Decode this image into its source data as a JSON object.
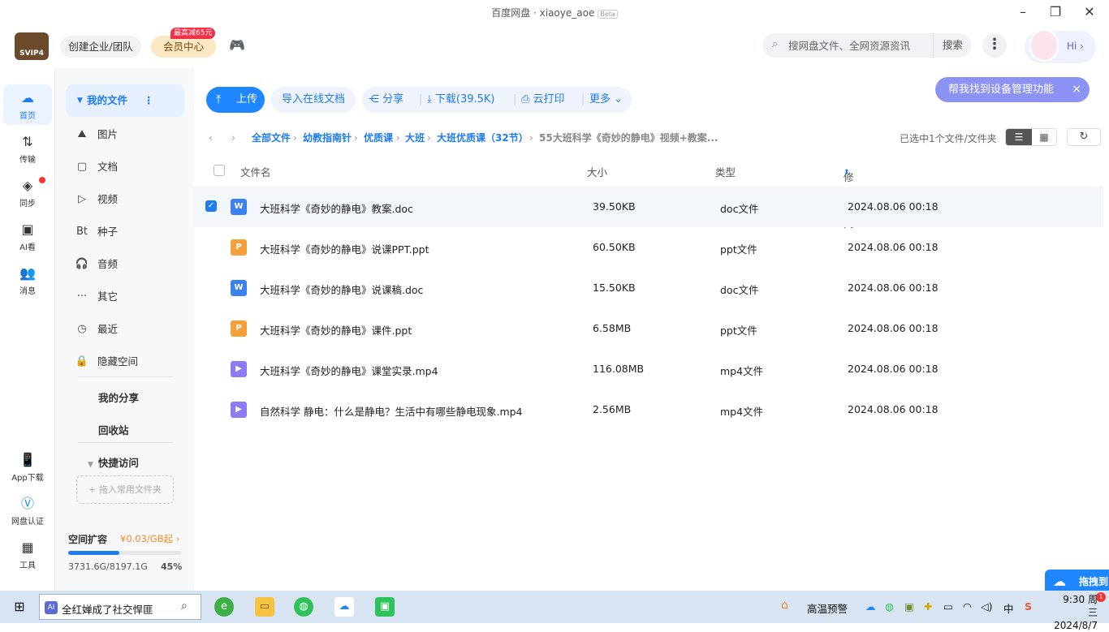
{
  "window": {
    "title": "百度网盘 · xiaoye_aoe",
    "beta": "Beta"
  },
  "topbar": {
    "logo": "SVIP4",
    "create_enterprise": "创建企业/团队",
    "vip_center": "会员中心",
    "vip_badge": "最高减65元",
    "search_placeholder": "搜网盘文件、全网资源资讯",
    "search_button": "搜索",
    "hi": "Hi"
  },
  "rail": {
    "items": [
      {
        "label": "首页",
        "icon": "cloud-icon"
      },
      {
        "label": "传输",
        "icon": "transfer-icon"
      },
      {
        "label": "同步",
        "icon": "sync-icon"
      },
      {
        "label": "AI看",
        "icon": "ai-icon"
      },
      {
        "label": "消息",
        "icon": "message-icon"
      },
      {
        "label": "App下载",
        "icon": "phone-icon"
      },
      {
        "label": "网盘认证",
        "icon": "verify-icon"
      },
      {
        "label": "工具",
        "icon": "tools-icon"
      }
    ]
  },
  "sidebar": {
    "my_files": "我的文件",
    "categories": [
      {
        "label": "图片",
        "icon": "image-icon"
      },
      {
        "label": "文档",
        "icon": "document-icon"
      },
      {
        "label": "视频",
        "icon": "video-icon"
      },
      {
        "label": "种子",
        "icon": "torrent-icon"
      },
      {
        "label": "音频",
        "icon": "audio-icon"
      },
      {
        "label": "其它",
        "icon": "other-icon"
      },
      {
        "label": "最近",
        "icon": "recent-icon"
      },
      {
        "label": "隐藏空间",
        "icon": "lock-icon"
      }
    ],
    "my_share": "我的分享",
    "recycle": "回收站",
    "quick_access": "快捷访问",
    "drop_hint": "+ 拖入常用文件夹",
    "quota": {
      "title": "空间扩容",
      "price": "¥0.03/GB起",
      "used_text": "3731.6G/8197.1G",
      "percent_text": "45%",
      "percent": 0.45
    }
  },
  "toolbar": {
    "upload": "上传",
    "import_doc": "导入在线文档",
    "share": "分享",
    "download": "下载(39.5K)",
    "cloud_print": "云打印",
    "more": "更多"
  },
  "helper": {
    "text": "帮我找到设备管理功能"
  },
  "breadcrumb": {
    "items": [
      "全部文件",
      "幼教指南针",
      "优质课",
      "大班",
      "大班优质课（32节）",
      "55大班科学《奇妙的静电》视频+教案..."
    ]
  },
  "selection_info": "已选中1个文件/文件夹",
  "table": {
    "headers": {
      "name": "文件名",
      "size": "大小",
      "type": "类型",
      "modified": "修改时间"
    },
    "rows": [
      {
        "name": "大班科学《奇妙的静电》教案.doc",
        "size": "39.50KB",
        "type": "doc文件",
        "modified": "2024.08.06 00:18",
        "kind": "doc",
        "selected": true
      },
      {
        "name": "大班科学《奇妙的静电》说课PPT.ppt",
        "size": "60.50KB",
        "type": "ppt文件",
        "modified": "2024.08.06 00:18",
        "kind": "ppt",
        "selected": false
      },
      {
        "name": "大班科学《奇妙的静电》说课稿.doc",
        "size": "15.50KB",
        "type": "doc文件",
        "modified": "2024.08.06 00:18",
        "kind": "doc",
        "selected": false
      },
      {
        "name": "大班科学《奇妙的静电》课件.ppt",
        "size": "6.58MB",
        "type": "ppt文件",
        "modified": "2024.08.06 00:18",
        "kind": "ppt",
        "selected": false
      },
      {
        "name": "大班科学《奇妙的静电》课堂实录.mp4",
        "size": "116.08MB",
        "type": "mp4文件",
        "modified": "2024.08.06 00:18",
        "kind": "mp4",
        "selected": false
      },
      {
        "name": "自然科学 静电：什么是静电？生活中有哪些静电现象.mp4",
        "size": "2.56MB",
        "type": "mp4文件",
        "modified": "2024.08.06 00:18",
        "kind": "mp4",
        "selected": false
      }
    ]
  },
  "floating": {
    "label": "拖拽到"
  },
  "taskbar": {
    "search_text": "全红婵成了社交悍匪",
    "ai_label": "AI",
    "weather": "高温预警",
    "ime": "中",
    "time": "9:30 周三",
    "date": "2024/8/7",
    "notif_count": "1"
  }
}
